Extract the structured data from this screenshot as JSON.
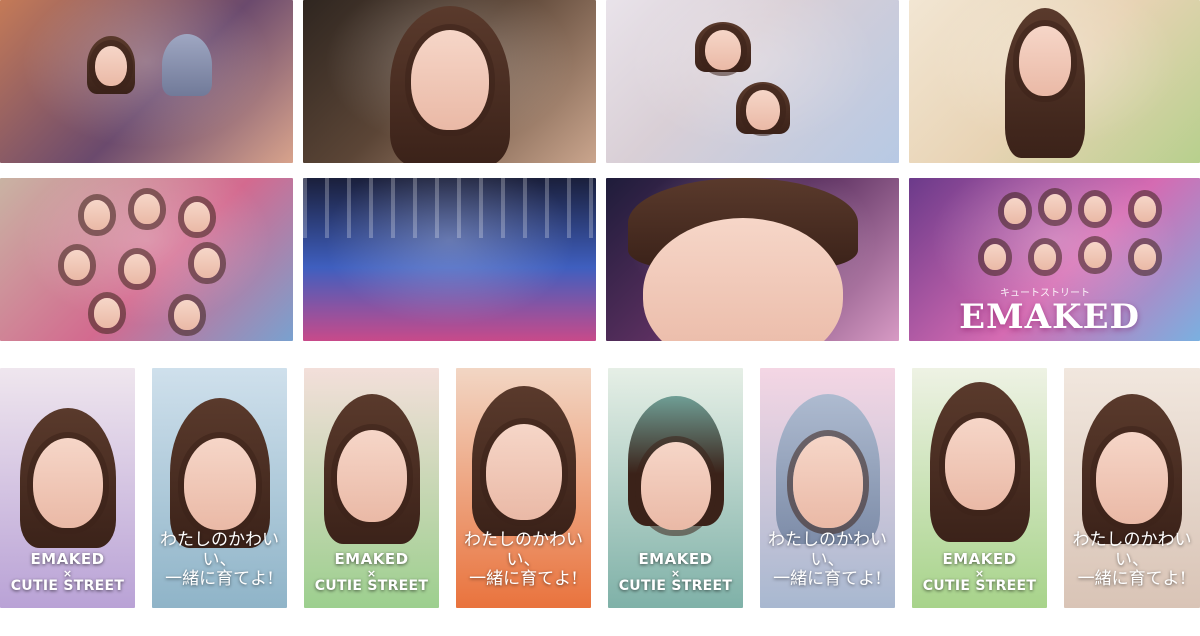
{
  "gallery": {
    "row1": [
      {
        "name": "photo-living-room-two-girls",
        "colors": [
          "#c47a57",
          "#6b4a6d",
          "#d8a38c"
        ]
      },
      {
        "name": "photo-girl-straw-headband",
        "colors": [
          "#5b4536",
          "#caa58d",
          "#2f2620"
        ]
      },
      {
        "name": "photo-two-girls-lying-bed",
        "colors": [
          "#e9e3ea",
          "#b7c9e4",
          "#d9cfd6"
        ]
      },
      {
        "name": "photo-girl-green-top-makeup",
        "colors": [
          "#e8d3b4",
          "#b7d08d",
          "#f2e6d3"
        ]
      }
    ],
    "row2": [
      {
        "name": "photo-group-room",
        "colors": [
          "#c9b3a3",
          "#d36a8f",
          "#79a1cf"
        ]
      },
      {
        "name": "photo-concert-stage",
        "colors": [
          "#1a1f3b",
          "#3f5fbf",
          "#c84a8a"
        ]
      },
      {
        "name": "photo-closeup-eyes",
        "colors": [
          "#5a2f5f",
          "#d79ac4",
          "#1e1c3a"
        ]
      },
      {
        "name": "photo-group-balloons",
        "colors": [
          "#6b3a8a",
          "#d56bb2",
          "#7ab0e0"
        ]
      }
    ],
    "row2_caption": {
      "sub": "キュートストリート",
      "brand": "EMAKED"
    },
    "row3": [
      {
        "name": "portrait-1",
        "colors": [
          "#efe6ee",
          "#b9a2d6"
        ],
        "overlay": "brand"
      },
      {
        "name": "portrait-2",
        "colors": [
          "#cfe0ec",
          "#8fb4c8"
        ],
        "overlay": "phrase"
      },
      {
        "name": "portrait-3",
        "colors": [
          "#f3dfda",
          "#9ccf8e"
        ],
        "overlay": "brand"
      },
      {
        "name": "portrait-4",
        "colors": [
          "#f2d6c4",
          "#e9733d"
        ],
        "overlay": "phrase"
      },
      {
        "name": "portrait-5",
        "colors": [
          "#e6efe6",
          "#7fb1a8"
        ],
        "overlay": "brand"
      },
      {
        "name": "portrait-6",
        "colors": [
          "#f4d6e4",
          "#a8b8d0"
        ],
        "overlay": "phrase"
      },
      {
        "name": "portrait-7",
        "colors": [
          "#eef2e4",
          "#a7d38a"
        ],
        "overlay": "brand"
      },
      {
        "name": "portrait-8",
        "colors": [
          "#f1e7de",
          "#d9c4b6"
        ],
        "overlay": "phrase"
      }
    ],
    "brand_overlay": {
      "top": "EMAKED",
      "x": "×",
      "bottom": "CUTIE STREET"
    },
    "phrase_overlay": "わたしのかわいい、\n一緒に育てよ!"
  }
}
